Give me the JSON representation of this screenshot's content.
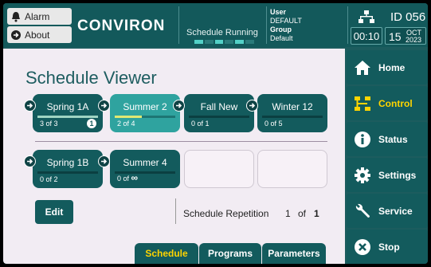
{
  "header": {
    "alarm_label": "Alarm",
    "about_label": "About",
    "logo": "CONVIRON",
    "schedule_status": "Schedule Running",
    "user_label": "User",
    "user_value": "DEFAULT",
    "group_label": "Group",
    "group_value": "Default",
    "id_text": "ID  056",
    "time": "00:10",
    "day": "15",
    "month": "OCT",
    "year": "2023"
  },
  "main": {
    "title": "Schedule Viewer",
    "row1": [
      {
        "name": "Spring 1A",
        "count": "3 of 3",
        "progress": 1.0,
        "badge": "1",
        "active": false
      },
      {
        "name": "Summer 2",
        "count": "2 of 4",
        "progress": 0.5,
        "active": true
      },
      {
        "name": "Fall New",
        "count": "0 of 1",
        "progress": 0,
        "active": false
      },
      {
        "name": "Winter 12",
        "count": "0 of 5",
        "progress": 0,
        "active": false
      }
    ],
    "row2": [
      {
        "name": "Spring 1B",
        "count": "0 of 2",
        "progress": 0
      },
      {
        "name": "Summer 4",
        "count": "0 of",
        "infinity": "∞",
        "progress": 0
      }
    ],
    "edit_label": "Edit",
    "repetition_label": "Schedule Repetition",
    "repetition_current": "1",
    "repetition_of": "of",
    "repetition_total": "1",
    "tabs": [
      "Schedule",
      "Programs",
      "Parameters"
    ],
    "active_tab": "Schedule"
  },
  "nav": {
    "items": [
      {
        "label": "Home",
        "icon": "home-icon"
      },
      {
        "label": "Control",
        "icon": "control-icon",
        "active": true
      },
      {
        "label": "Status",
        "icon": "info-icon"
      },
      {
        "label": "Settings",
        "icon": "gear-icon"
      },
      {
        "label": "Service",
        "icon": "wrench-icon"
      },
      {
        "label": "Stop",
        "icon": "stop-icon"
      }
    ]
  },
  "colors": {
    "teal_dark": "#135b5d",
    "teal_active": "#2fa39f",
    "accent_yellow": "#ffd400",
    "panel_bg": "#f2ecf3"
  }
}
